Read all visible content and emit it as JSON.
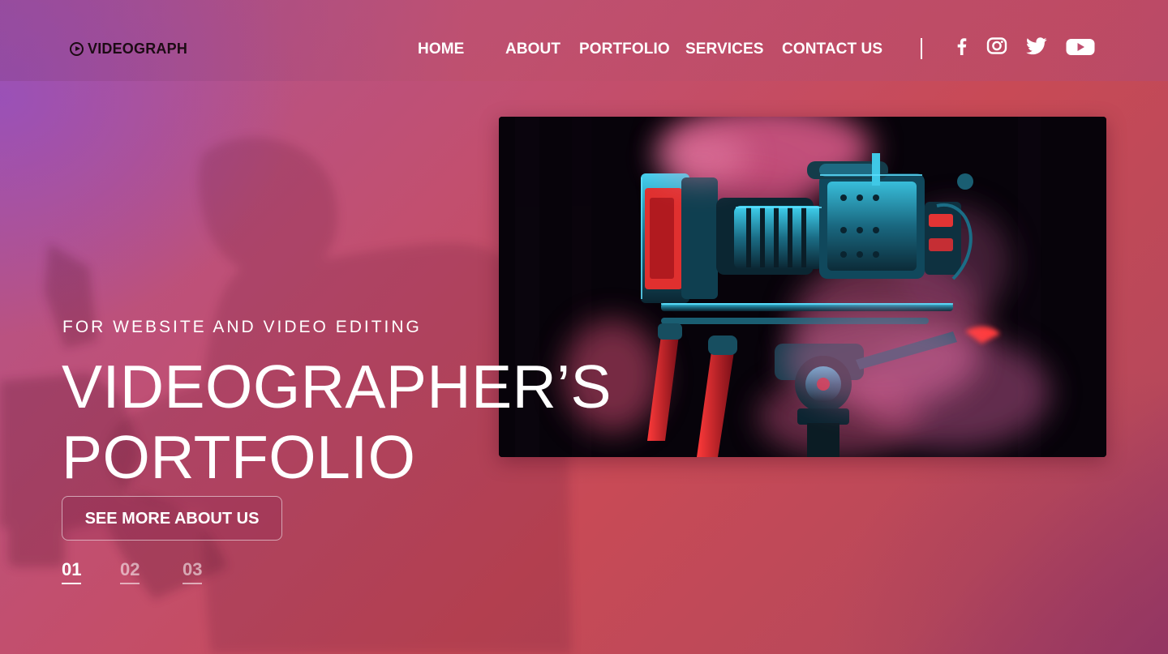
{
  "brand": {
    "name": "VIDEOGRAPH",
    "logo_icon": "play-circle-icon"
  },
  "nav": {
    "items": [
      {
        "label": "HOME"
      },
      {
        "label": "ABOUT"
      },
      {
        "label": "PORTFOLIO"
      },
      {
        "label": "SERVICES"
      },
      {
        "label": "CONTACT US"
      }
    ]
  },
  "social": {
    "icons": [
      "facebook-icon",
      "instagram-icon",
      "twitter-icon",
      "youtube-icon"
    ]
  },
  "hero": {
    "eyebrow": "FOR WEBSITE AND VIDEO EDITING",
    "title_line1": "VIDEOGRAPHER’S",
    "title_line2": "PORTFOLIO",
    "cta_label": "SEE MORE ABOUT US",
    "slides": [
      {
        "label": "01",
        "active": true
      },
      {
        "label": "02",
        "active": false
      },
      {
        "label": "03",
        "active": false
      }
    ]
  },
  "colors": {
    "background_start": "#b05595",
    "background_mid": "#c84a56",
    "background_end": "#9c3a66",
    "logo_text": "#1c0b14",
    "text": "#ffffff",
    "camera_accent": "#2ec4e6",
    "smoke": "#e0608a"
  }
}
